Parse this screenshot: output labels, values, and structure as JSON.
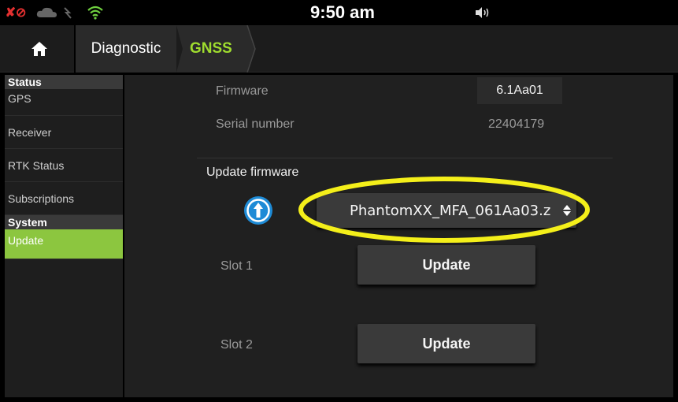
{
  "statusbar": {
    "time": "9:50 am",
    "icons": [
      "gps-off-icon",
      "cloud-sync-icon",
      "wifi-icon",
      "volume-icon"
    ],
    "gps_off_glyph": "✘⊘"
  },
  "navbar": {
    "home_icon": "home-icon",
    "breadcrumbs": [
      "Diagnostic",
      "GNSS"
    ]
  },
  "sidebar": {
    "sections": [
      {
        "header": "Status",
        "items": [
          {
            "label": "GPS"
          },
          {
            "label": "Receiver"
          },
          {
            "label": "RTK Status"
          },
          {
            "label": "Subscriptions"
          }
        ]
      },
      {
        "header": "System",
        "items": [
          {
            "label": "Update",
            "active": true
          }
        ]
      }
    ]
  },
  "main": {
    "firmware_label": "Firmware",
    "firmware_value": "6.1Aa01",
    "serial_label": "Serial number",
    "serial_value": "22404179",
    "update_firmware_label": "Update firmware",
    "upload_icon": "upload-icon",
    "file_select_value": "PhantomXX_MFA_061Aa03.z",
    "slots": [
      {
        "label": "Slot 1",
        "button": "Update"
      },
      {
        "label": "Slot 2",
        "button": "Update"
      }
    ]
  },
  "colors": {
    "accent_green": "#8cc63f",
    "breadcrumb_active": "#9fdc2e",
    "icon_blue": "#1e8bd6",
    "highlight_yellow": "#f4ef1a",
    "gps_off_red": "#e43030"
  }
}
